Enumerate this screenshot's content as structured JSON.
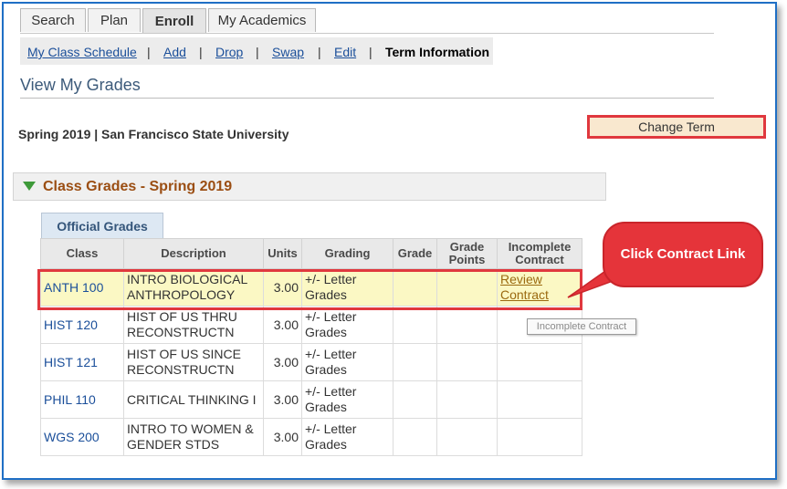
{
  "tabs": [
    {
      "label": "Search"
    },
    {
      "label": "Plan"
    },
    {
      "label": "Enroll"
    },
    {
      "label": "My Academics"
    }
  ],
  "subnav": {
    "items": [
      "My Class Schedule",
      "Add",
      "Drop",
      "Swap",
      "Edit"
    ],
    "current": "Term Information",
    "separator": "|"
  },
  "page": {
    "title": "View My Grades",
    "term_line": "Spring 2019 | San Francisco State University",
    "change_term_label": "Change Term"
  },
  "section": {
    "title": "Class Grades - Spring 2019",
    "subtab": "Official Grades"
  },
  "table": {
    "headers": [
      "Class",
      "Description",
      "Units",
      "Grading",
      "Grade",
      "Grade Points",
      "Incomplete Contract"
    ],
    "rows": [
      {
        "class": "ANTH 100",
        "description": "INTRO BIOLOGICAL ANTHROPOLOGY",
        "units": "3.00",
        "grading": "+/- Letter Grades",
        "grade": "",
        "grade_points": "",
        "contract": "Review Contract"
      },
      {
        "class": "HIST 120",
        "description": "HIST OF US THRU RECONSTRUCTN",
        "units": "3.00",
        "grading": "+/- Letter Grades",
        "grade": "",
        "grade_points": "",
        "contract": ""
      },
      {
        "class": "HIST 121",
        "description": "HIST OF US SINCE RECONSTRUCTN",
        "units": "3.00",
        "grading": "+/- Letter Grades",
        "grade": "",
        "grade_points": "",
        "contract": ""
      },
      {
        "class": "PHIL 110",
        "description": "CRITICAL THINKING I",
        "units": "3.00",
        "grading": "+/- Letter Grades",
        "grade": "",
        "grade_points": "",
        "contract": ""
      },
      {
        "class": "WGS 200",
        "description": "INTRO TO WOMEN & GENDER STDS",
        "units": "3.00",
        "grading": "+/- Letter Grades",
        "grade": "",
        "grade_points": "",
        "contract": ""
      }
    ]
  },
  "tooltip": "Incomplete Contract",
  "callout": "Click Contract Link",
  "colors": {
    "link": "#1b4f9a",
    "highlight": "#fbf8c4",
    "annotation_red": "#e0383e",
    "section_title": "#9b4e13"
  },
  "icons": {
    "section_toggle": "triangle-down-icon"
  }
}
